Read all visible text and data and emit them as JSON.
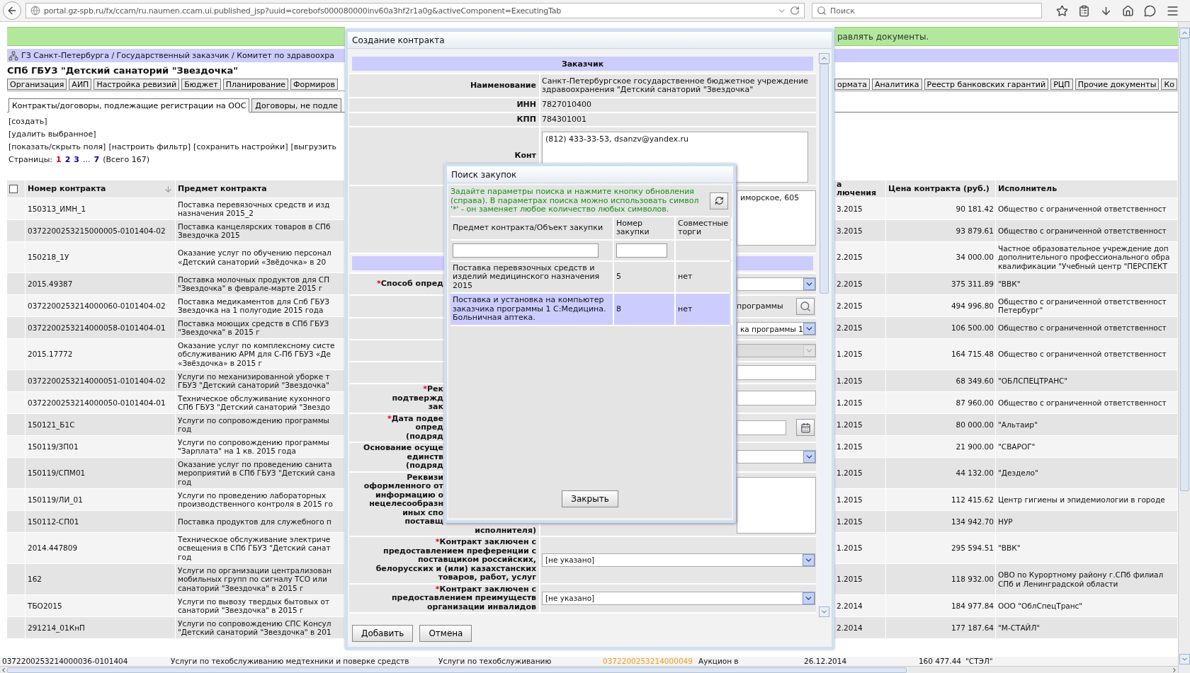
{
  "browser": {
    "url": "portal.gz-spb.ru/fx/ccam/ru.naumen.ccam.ui.published_jsp?uuid=corebofs000080000inv60a3hf2r1a0g&activeComponent=ExecutingTab",
    "search_placeholder": "Поиск"
  },
  "left": {
    "breadcrumb": "ГЗ Санкт-Петербурга / Государственный заказчик / Комитет по здравоохра",
    "title": "СПб ГБУЗ \"Детский санаторий \"Звездочка\"",
    "tabs": [
      "Организация",
      "АИП",
      "Настройка ревизий",
      "Бюджет",
      "Планирование",
      "Формиров"
    ],
    "subtabs": [
      {
        "label": "Контракты/договоры, подлежащие регистрации на ООС",
        "selected": true
      },
      {
        "label": "Договоры, не подле",
        "selected": false
      }
    ],
    "actions": [
      [
        "[создать]"
      ],
      [
        "[удалить выбранное]"
      ],
      [
        "[показать/скрыть поля]",
        "[настроить фильтр]",
        "[сохранить настройки]",
        "[выгрузить"
      ]
    ],
    "pager": {
      "label": "Страницы:",
      "pages": [
        {
          "label": "1",
          "selected": true
        },
        {
          "label": "2",
          "selected": false
        },
        {
          "label": "3",
          "selected": false
        },
        {
          "label": "7",
          "selected": false
        }
      ],
      "gap": "...",
      "total": "(Всего 167)"
    },
    "select_all": {
      "checked": false
    },
    "columns": [
      {
        "label": "Номер контракта",
        "sorted": true
      },
      {
        "label": "Предмет контракта",
        "sorted": false
      }
    ],
    "rows": [
      {
        "number": "150313_ИМН_1",
        "subject": "Поставка перевязочных средств и изд\nназначения 2015_2"
      },
      {
        "number": "0372200253215000005-0101404-02",
        "subject": "Поставка канцелярских товаров в СПб\nЗвездочка 2015"
      },
      {
        "number": "150218_1У",
        "subject": "Оказание услуг по обучению персонал\n«Детский санаторий «Звёдочка» в 20"
      },
      {
        "number": "2015.49387",
        "subject": "Поставка молочных продуктов для СП\n\"Звездочка\" в феврале-марте 2015 г"
      },
      {
        "number": "0372200253214000060-0101404-02",
        "subject": "Поставка медикаментов для Спб ГБУЗ\nЗвездочка на 1 полугодие 2015 года"
      },
      {
        "number": "0372200253214000058-0101404-01",
        "subject": "Поставка моющих средств в СПб ГБУЗ\n\"Звездочка\" в 2015 г"
      },
      {
        "number": "2015.17772",
        "subject": "Оказание услуг по комплексному систе\nобслуживанию АРМ для С-Пб ГБУЗ «Де\n«Звёздочка» в 2015 г"
      },
      {
        "number": "0372200253214000051-0101404-02",
        "subject": "Услуги по механизированной уборке т\nГБУЗ \"Детский санаторий \"Звездочка\""
      },
      {
        "number": "0372200253214000050-0101404-01",
        "subject": "Техническое обслуживание кухонного\nСПб ГБУЗ \"Детский санаторий \"Звездо"
      },
      {
        "number": "150121_Б1С",
        "subject": "Услуги по сопровождению программы\nгод"
      },
      {
        "number": "150119/ЗП01",
        "subject": "Услуги по сопровождению программы\n\"Зарплата\" на 1 кв. 2015 года"
      },
      {
        "number": "150119/СПМ01",
        "subject": "Оказание услуг по проведению санита\nмероприятий в СПб ГБУЗ \"Детский сана\nгод"
      },
      {
        "number": "150119/ЛИ_01",
        "subject": "Услуги по проведению лабораторных\nпроизводственного контроля в 2015 го"
      },
      {
        "number": "150112-СП01",
        "subject": "Поставка продуктов для служебного п"
      },
      {
        "number": "2014.447809",
        "subject": "Техническое обслуживание электриче\nосвещения в СПб ГБУЗ \"Детский санат\nгод"
      },
      {
        "number": "162",
        "subject": "Услуги по организации централизован\nмобильных групп по сигналу ТСО или\nсанаторий \"Звездочка\" в 2015 г"
      },
      {
        "number": "ТБО2015",
        "subject": "Услуги по вывозу твердых бытовых от\nсанаторий \"Звездочка\" в 2015 г"
      },
      {
        "number": "291214_01КнП",
        "subject": "Услуги по сопровождению СПС Консул\n\"Детский санаторий \"Звездочка\" в 201"
      }
    ]
  },
  "right": {
    "notice": "равлять документы.",
    "tabs": [
      "ормата",
      "Аналитика",
      "Реестр банковских гарантий",
      "РЦП",
      "Прочие документы",
      "Ко"
    ],
    "columns": [
      "а\nлючения",
      "Цена контракта (руб.)",
      "Исполнитель"
    ],
    "rows": [
      {
        "date": "3.2015",
        "price": "90 181.42",
        "executor": "Общество с ограниченной ответственност"
      },
      {
        "date": "3.2015",
        "price": "93 879.61",
        "executor": "Общество с ограниченной ответственност"
      },
      {
        "date": "2.2015",
        "price": "34 000.00",
        "executor": "Частное образовательное учреждение доп\nдополнительного профессионального обра\nквалификации \"Учебный центр \"ПЕРСПЕКТ"
      },
      {
        "date": "2.2015",
        "price": "375 311.89",
        "executor": "\"ВВК\""
      },
      {
        "date": "2.2015",
        "price": "494 996.80",
        "executor": "Общество с ограниченной ответственност\nПетербург\""
      },
      {
        "date": "2.2015",
        "price": "106 500.00",
        "executor": "Общество с ограниченной ответственност"
      },
      {
        "date": "1.2015",
        "price": "164 715.48",
        "executor": "Общество с ограниченной ответственност"
      },
      {
        "date": "1.2015",
        "price": "68 349.60",
        "executor": "\"ОБЛСПЕЦТРАНС\""
      },
      {
        "date": "1.2015",
        "price": "87 960.00",
        "executor": "Общество с ограниченной ответственност"
      },
      {
        "date": "1.2015",
        "price": "80 000.00",
        "executor": "\"Альтаир\""
      },
      {
        "date": "1.2015",
        "price": "21 900.00",
        "executor": "\"СВАРОГ\""
      },
      {
        "date": "1.2015",
        "price": "44 132.00",
        "executor": "\"Дездело\""
      },
      {
        "date": "1.2015",
        "price": "112 415.62",
        "executor": "Центр гигиены и эпидемиологии в городе"
      },
      {
        "date": "1.2015",
        "price": "134 942.70",
        "executor": "НУР"
      },
      {
        "date": "1.2015",
        "price": "295 594.51",
        "executor": "\"ВВК\""
      },
      {
        "date": "1.2015",
        "price": "118 932.00",
        "executor": "ОВО по Курортному району г.СПб филиал\nСПб и Ленинградской области"
      },
      {
        "date": "2.2014",
        "price": "184 977.84",
        "executor": "ООО \"ОблСпецТранс\""
      },
      {
        "date": "2.2014",
        "price": "177 187.64",
        "executor": "\"М-СТАЙЛ\""
      }
    ]
  },
  "bottom_row": [
    {
      "kind": "text",
      "text": "0372200253214000036-0101404"
    },
    {
      "kind": "text",
      "text": "Услуги по техобслуживанию медтехники и поверке средств"
    },
    {
      "kind": "text",
      "text": "Услуги по техобслуживанию"
    },
    {
      "kind": "link",
      "text": "0372200253214000049"
    },
    {
      "kind": "text",
      "text": "Аукцион в"
    },
    {
      "kind": "text",
      "text": "26.12.2014"
    },
    {
      "kind": "number",
      "text": "160 477.44"
    },
    {
      "kind": "text",
      "text": "\"СТЭЛ\""
    }
  ],
  "dialog": {
    "title": "Создание контракта",
    "items": [
      {
        "kind": "section",
        "label": "Заказчик"
      },
      {
        "kind": "text",
        "label": "Наименование",
        "value": "Санкт-Петербургское государственное бюджетное учреждение\nздравоохранения \"Детский санаторий \"Звездочка\""
      },
      {
        "kind": "text",
        "label": "ИНН",
        "value": "7827010400"
      },
      {
        "kind": "text",
        "label": "КПП",
        "value": "784301001"
      },
      {
        "kind": "textarea",
        "label": "Конт",
        "value": "(812) 433-33-53, dsanzv@yandex.ru",
        "covered": false
      },
      {
        "kind": "textarea",
        "value": "иморское, 605",
        "covered": true
      },
      {
        "kind": "section"
      },
      {
        "kind": "select",
        "required_mark": "*",
        "label": "Способ опред",
        "covered": true
      },
      {
        "kind": "lookup",
        "value": "программы",
        "covered": true
      },
      {
        "kind": "select",
        "value": "ка программы 1",
        "covered": true
      },
      {
        "kind": "select",
        "disabled": true,
        "covered": true
      },
      {
        "kind": "input",
        "covered": true
      },
      {
        "kind": "input",
        "required_mark": "*",
        "label": "Рек\nподтвержд\nзак",
        "covered": true
      },
      {
        "kind": "date",
        "required_mark": "*",
        "label": "Дата подве\nопред\n(подряд",
        "covered": true
      },
      {
        "kind": "select",
        "label": "Основание осуще\nединств\n(подряд",
        "covered": true
      },
      {
        "kind": "textarea",
        "label": "Реквизи\nоформленного от\nинформацию о\nнецелесообразн\nиных спо\nпоставщ",
        "label_tail": "исполнителя)",
        "covered": true
      },
      {
        "kind": "select",
        "required_mark": "*",
        "label": "Контракт заключен с\nпредоставлением преференции с\nпоставщиком российских,\nбелорусских и (или) казахстанских\nтоваров, работ, услуг",
        "value": "[не указано]",
        "covered": false
      },
      {
        "kind": "select",
        "required_mark": "*",
        "label": "Контракт заключен с\nпредоставлением преимуществ\nорганизации инвалидов",
        "value": "[не указано]",
        "covered": false
      }
    ],
    "buttons": [
      "Добавить",
      "Отмена"
    ]
  },
  "search_dialog": {
    "title": "Поиск закупок",
    "hint": "Задайте параметры поиска и нажмите кнопку обновления (справа). В параметрах поиска можно использовать символ '*' - он заменяет любое количество любых символов.",
    "columns": [
      "Предмет контракта/Объект закупки",
      "Номер\nзакупки",
      "Совместные\nторги"
    ],
    "rows": [
      {
        "subject": "Поставка перевязочных средств и\nизделий медицинского назначения\n2015",
        "number": "5",
        "joint": "нет",
        "selected": false
      },
      {
        "subject": "Поставка и установка на компьютер\nзаказчика программы 1 С:Медицина.\nБольничная аптека.",
        "number": "8",
        "joint": "нет",
        "selected": true
      }
    ],
    "close": "Закрыть"
  }
}
